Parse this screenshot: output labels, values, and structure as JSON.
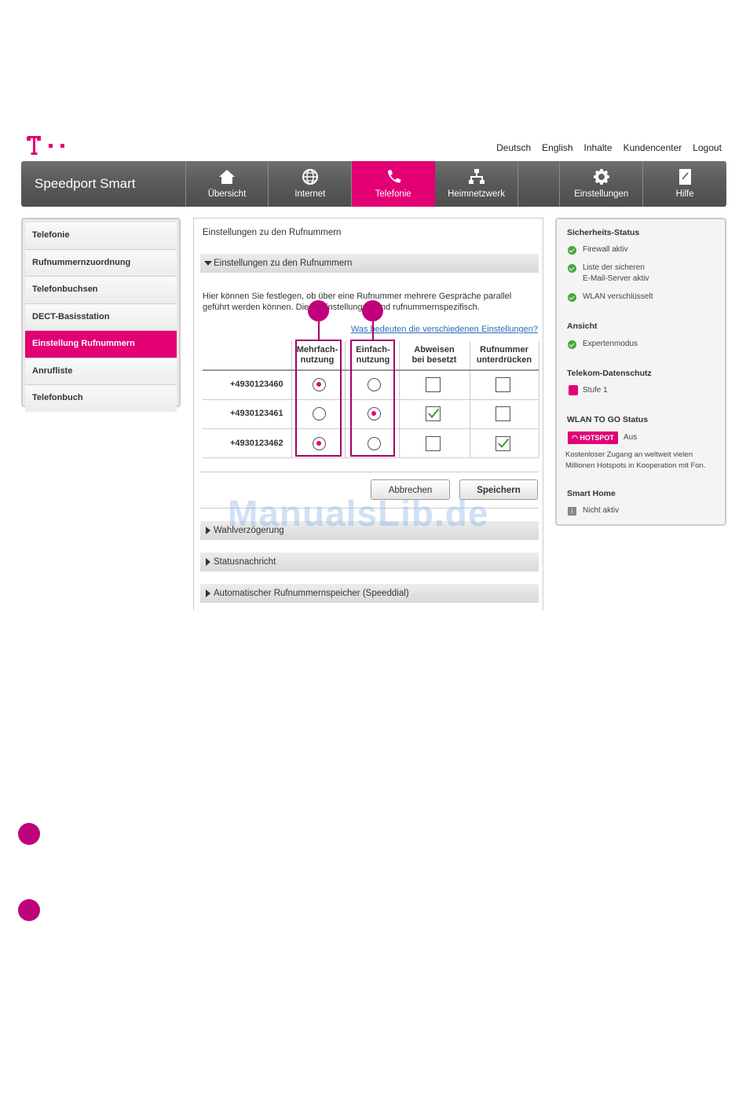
{
  "top_links": [
    "Deutsch",
    "English",
    "Inhalte",
    "Kundencenter",
    "Logout"
  ],
  "brand": "Speedport Smart",
  "nav": [
    {
      "label": "Übersicht",
      "icon": "home-icon"
    },
    {
      "label": "Internet",
      "icon": "globe-icon"
    },
    {
      "label": "Telefonie",
      "icon": "phone-icon",
      "active": true
    },
    {
      "label": "Heimnetzwerk",
      "icon": "network-icon"
    },
    {
      "label": "Einstellungen",
      "icon": "gear-icon"
    },
    {
      "label": "Hilfe",
      "icon": "help-book-icon"
    }
  ],
  "sidebar": {
    "items": [
      {
        "label": "Telefonie"
      },
      {
        "label": "Rufnummernzuordnung"
      },
      {
        "label": "Telefonbuchsen"
      },
      {
        "label": "DECT-Basisstation"
      },
      {
        "label": "Einstellung Rufnummern",
        "active": true
      },
      {
        "label": "Anrufliste"
      },
      {
        "label": "Telefonbuch"
      }
    ]
  },
  "main": {
    "title": "Einstellungen zu den Rufnummern",
    "section_open": "Einstellungen zu den Rufnummern",
    "description": "Hier können Sie festlegen, ob über eine Rufnummer mehrere Gespräche parallel geführt werden können. Diese Einstellungen sind rufnummernspezifisch.",
    "help_link": "Was bedeuten die verschiedenen Einstellungen?",
    "columns": [
      {
        "line1": "Mehrfach-",
        "line2": "nutzung"
      },
      {
        "line1": "Einfach-",
        "line2": "nutzung"
      },
      {
        "line1": "Abweisen",
        "line2": "bei besetzt"
      },
      {
        "line1": "Rufnummer",
        "line2": "unterdrücken"
      }
    ],
    "rows": [
      {
        "number": "+4930123460",
        "usage": "mehrfach",
        "abweisen": false,
        "unterdruecken": false
      },
      {
        "number": "+4930123461",
        "usage": "einfach",
        "abweisen": true,
        "unterdruecken": false
      },
      {
        "number": "+4930123462",
        "usage": "mehrfach",
        "abweisen": false,
        "unterdruecken": true
      }
    ],
    "cancel_label": "Abbrechen",
    "save_label": "Speichern",
    "collapsed_sections": [
      "Wahlverzögerung",
      "Statusnachricht",
      "Automatischer Rufnummernspeicher (Speeddial)"
    ]
  },
  "watermark": "ManualsLib.de",
  "status": {
    "security_heading": "Sicherheits-Status",
    "firewall": "Firewall aktiv",
    "email_line1": "Liste der sicheren",
    "email_line2": "E-Mail-Server aktiv",
    "wlan": "WLAN verschlüsselt",
    "view_heading": "Ansicht",
    "expert": "Expertenmodus",
    "privacy_heading": "Telekom-Datenschutz",
    "privacy_level": "Stufe 1",
    "wlan_to_go_heading": "WLAN TO GO Status",
    "hotspot_badge": "HOTSPOT",
    "hotspot_state": "Aus",
    "hotspot_desc_line1": "Kostenloser Zugang an weltweit vielen",
    "hotspot_desc_line2": "Millionen Hotspots in Kooperation mit Fon.",
    "smarthome_heading": "Smart Home",
    "smarthome_state": "Nicht aktiv"
  },
  "colors": {
    "magenta": "#e20074",
    "callout": "#c0007a",
    "ok_green": "#4aa53f"
  }
}
